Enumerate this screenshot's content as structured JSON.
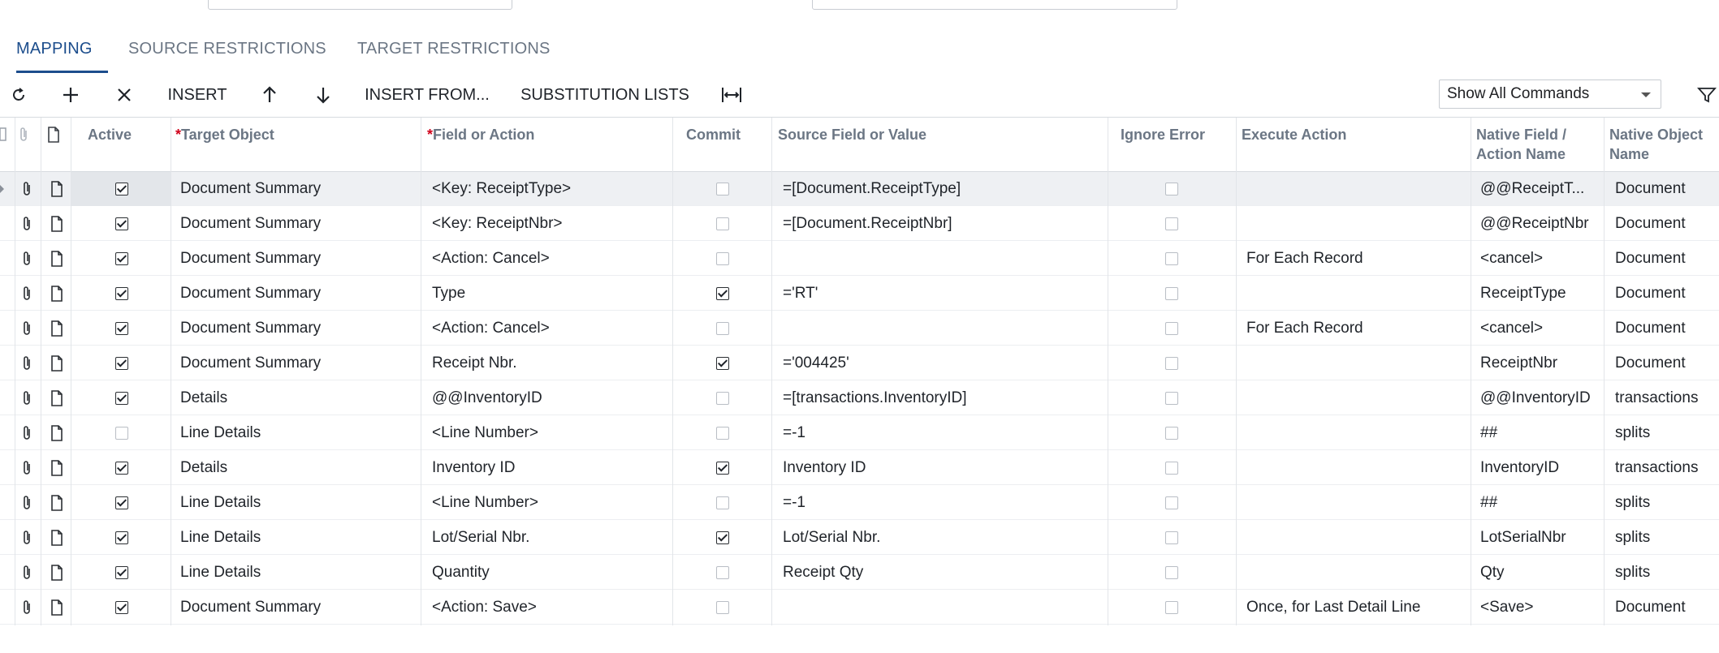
{
  "tabs": [
    {
      "label": "MAPPING",
      "active": true
    },
    {
      "label": "SOURCE RESTRICTIONS",
      "active": false
    },
    {
      "label": "TARGET RESTRICTIONS",
      "active": false
    }
  ],
  "toolbar": {
    "refresh_icon": "refresh-icon",
    "add_icon": "plus-icon",
    "delete_icon": "close-icon",
    "insert_label": "INSERT",
    "move_up_icon": "arrow-up-icon",
    "move_down_icon": "arrow-down-icon",
    "insert_from_label": "INSERT FROM...",
    "substitution_lists_label": "SUBSTITUTION LISTS",
    "fit_icon": "fit-columns-icon",
    "commands_select_value": "Show All Commands",
    "filter_icon": "filter-icon"
  },
  "columns": {
    "active": "Active",
    "target_object": "Target Object",
    "field_or_action": "Field or Action",
    "commit": "Commit",
    "source_field": "Source Field or Value",
    "ignore_error": "Ignore Error",
    "execute_action": "Execute Action",
    "native_field": "Native Field / Action Name",
    "native_field_line1": "Native Field /",
    "native_field_line2": "Action Name",
    "native_object": "Native Object Name",
    "native_object_line1": "Native Object",
    "native_object_line2": "Name"
  },
  "rows": [
    {
      "active": true,
      "target": "Document Summary",
      "field": "<Key: ReceiptType>",
      "commit": false,
      "source": "=[Document.ReceiptType]",
      "ignore": false,
      "execute": "",
      "native_field": "@@ReceiptT...",
      "native_object": "Document"
    },
    {
      "active": true,
      "target": "Document Summary",
      "field": "<Key: ReceiptNbr>",
      "commit": false,
      "source": "=[Document.ReceiptNbr]",
      "ignore": false,
      "execute": "",
      "native_field": "@@ReceiptNbr",
      "native_object": "Document"
    },
    {
      "active": true,
      "target": "Document Summary",
      "field": "<Action: Cancel>",
      "commit": false,
      "source": "",
      "ignore": false,
      "execute": "For Each Record",
      "native_field": "<cancel>",
      "native_object": "Document"
    },
    {
      "active": true,
      "target": "Document Summary",
      "field": "Type",
      "commit": true,
      "source": "='RT'",
      "ignore": false,
      "execute": "",
      "native_field": "ReceiptType",
      "native_object": "Document"
    },
    {
      "active": true,
      "target": "Document Summary",
      "field": "<Action: Cancel>",
      "commit": false,
      "source": "",
      "ignore": false,
      "execute": "For Each Record",
      "native_field": "<cancel>",
      "native_object": "Document"
    },
    {
      "active": true,
      "target": "Document Summary",
      "field": "Receipt Nbr.",
      "commit": true,
      "source": "='004425'",
      "ignore": false,
      "execute": "",
      "native_field": "ReceiptNbr",
      "native_object": "Document"
    },
    {
      "active": true,
      "target": "Details",
      "field": "@@InventoryID",
      "commit": false,
      "source": "=[transactions.InventoryID]",
      "ignore": false,
      "execute": "",
      "native_field": "@@InventoryID",
      "native_object": "transactions"
    },
    {
      "active": false,
      "target": "Line Details",
      "field": "<Line Number>",
      "commit": false,
      "source": "=-1",
      "ignore": false,
      "execute": "",
      "native_field": "##",
      "native_object": "splits"
    },
    {
      "active": true,
      "target": "Details",
      "field": "Inventory ID",
      "commit": true,
      "source": "Inventory ID",
      "ignore": false,
      "execute": "",
      "native_field": "InventoryID",
      "native_object": "transactions"
    },
    {
      "active": true,
      "target": "Line Details",
      "field": "<Line Number>",
      "commit": false,
      "source": "=-1",
      "ignore": false,
      "execute": "",
      "native_field": "##",
      "native_object": "splits"
    },
    {
      "active": true,
      "target": "Line Details",
      "field": "Lot/Serial Nbr.",
      "commit": true,
      "source": "Lot/Serial Nbr.",
      "ignore": false,
      "execute": "",
      "native_field": "LotSerialNbr",
      "native_object": "splits"
    },
    {
      "active": true,
      "target": "Line Details",
      "field": "Quantity",
      "commit": false,
      "source": "Receipt Qty",
      "ignore": false,
      "execute": "",
      "native_field": "Qty",
      "native_object": "splits"
    },
    {
      "active": true,
      "target": "Document Summary",
      "field": "<Action: Save>",
      "commit": false,
      "source": "",
      "ignore": false,
      "execute": "Once, for Last Detail Line",
      "native_field": "<Save>",
      "native_object": "Document"
    }
  ],
  "colors": {
    "accent": "#1c4d8c",
    "required": "#d0021b",
    "header_text": "#6b7684"
  }
}
